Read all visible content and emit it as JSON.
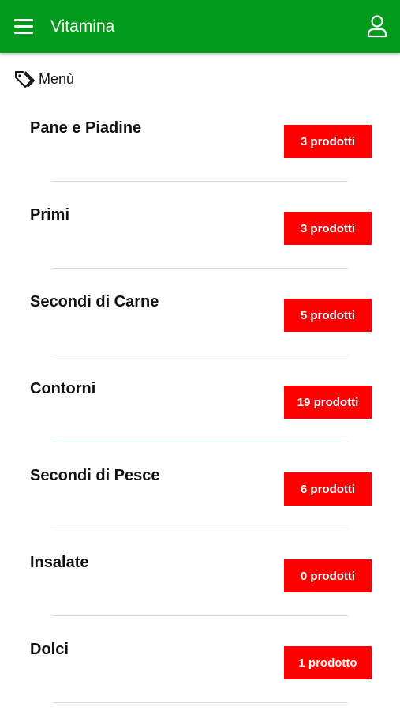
{
  "header": {
    "title": "Vitamina",
    "menu_icon": "hamburger-menu-icon",
    "profile_icon": "user-profile-icon",
    "color": "#019a1c"
  },
  "section": {
    "label": "Menù",
    "icon": "tag-icon"
  },
  "badge_color": "#fe0000",
  "categories": [
    {
      "name": "Pane e Piadine",
      "count": "3 prodotti"
    },
    {
      "name": "Primi",
      "count": "3 prodotti"
    },
    {
      "name": "Secondi di Carne",
      "count": "5 prodotti"
    },
    {
      "name": "Contorni",
      "count": "19 prodotti"
    },
    {
      "name": "Secondi di Pesce",
      "count": "6 prodotti"
    },
    {
      "name": "Insalate",
      "count": "0 prodotti"
    },
    {
      "name": "Dolci",
      "count": "1 prodotto"
    }
  ]
}
